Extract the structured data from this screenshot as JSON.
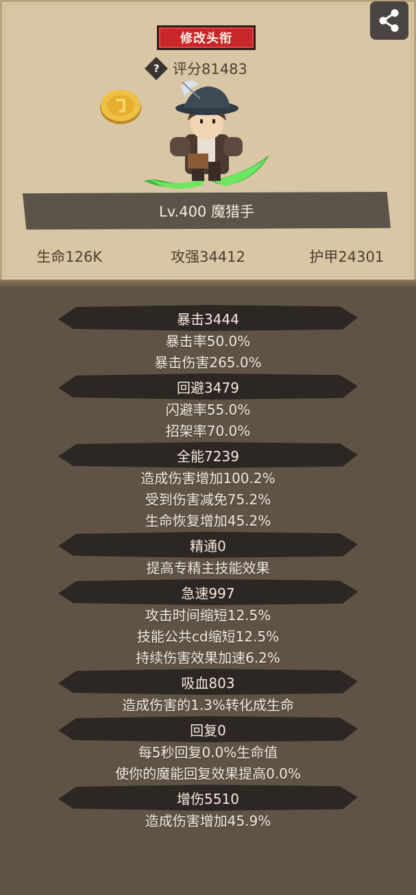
{
  "header": {
    "title_button": "修改头衔",
    "score": "评分81483",
    "help_glyph": "?",
    "share_icon": "share-icon"
  },
  "character": {
    "level_name": "Lv.400 魔猎手",
    "hp": "生命126K",
    "attack": "攻强34412",
    "armor": "护甲24301"
  },
  "stats": [
    {
      "title": "暴击3444",
      "lines": [
        "暴击率50.0%",
        "暴击伤害265.0%"
      ]
    },
    {
      "title": "回避3479",
      "lines": [
        "闪避率55.0%",
        "招架率70.0%"
      ]
    },
    {
      "title": "全能7239",
      "lines": [
        "造成伤害增加100.2%",
        "受到伤害减免75.2%",
        "生命恢复增加45.2%"
      ]
    },
    {
      "title": "精通0",
      "lines": [
        "提高专精主技能效果"
      ]
    },
    {
      "title": "急速997",
      "lines": [
        "攻击时间缩短12.5%",
        "技能公共cd缩短12.5%",
        "持续伤害效果加速6.2%"
      ]
    },
    {
      "title": "吸血803",
      "lines": [
        "造成伤害的1.3%转化成生命"
      ]
    },
    {
      "title": "回复0",
      "lines": [
        "每5秒回复0.0%生命值",
        "使你的魔能回复效果提高0.0%"
      ]
    },
    {
      "title": "增伤5510",
      "lines": [
        "造成伤害增加45.9%"
      ]
    }
  ],
  "colors": {
    "parchment": "#d8c6a4",
    "background": "#5e5344",
    "title_button": "#c8262a",
    "header_bar": "#2c2722",
    "blade_green": "#4fd34a"
  }
}
